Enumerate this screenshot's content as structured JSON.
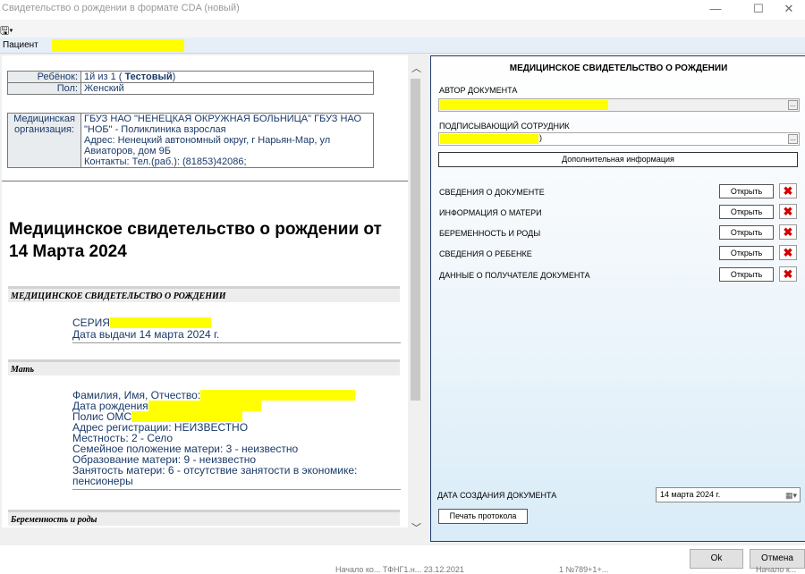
{
  "window": {
    "title": "Свидетельство о рождении в формате CDA (новый)",
    "minimize": "—",
    "maximize": "☐",
    "close": "✕"
  },
  "toolbar": {
    "menu_icon": "🖫▾"
  },
  "patient": {
    "label": "Пациент",
    "value": ""
  },
  "doc": {
    "child_label": "Ребёнок:",
    "child_value_prefix": "1й из 1 ( ",
    "child_value_bold": "Тестовый",
    "child_value_suffix": ")",
    "sex_label": "Пол:",
    "sex_value": "Женский",
    "org_label_1": "Медицинская",
    "org_label_2": "организация:",
    "org_line1": "ГБУЗ НАО \"НЕНЕЦКАЯ ОКРУЖНАЯ БОЛЬНИЦА\" ГБУЗ НАО",
    "org_line2": "\"НОБ\" - Поликлиника взрослая",
    "org_line3": "Адрес: Ненецкий автономный округ, г Нарьян-Мар, ул",
    "org_line4": "Авиаторов, дом 9Б",
    "org_line5": "Контакты: Тел.(раб.): (81853)42086;",
    "main_title": "Медицинское свидетельство о рождении от 14 Марта 2024",
    "section1_title": "МЕДИЦИНСКОЕ СВИДЕТЕЛЬСТВО О РОЖДЕНИИ",
    "series_label": "СЕРИЯ",
    "issue_date": "Дата выдачи 14 марта 2024 г.",
    "section2_title": "Мать",
    "mother_fio": "Фамилия, Имя, Отчество:",
    "mother_birth": "Дата рождения",
    "mother_oms": "Полис ОМС",
    "mother_addr": "Адрес регистрации: НЕИЗВЕСТНО",
    "mother_locality": "Местность: 2 - Село",
    "mother_family": "Семейное положение матери: 3 - неизвестно",
    "mother_edu": "Образование матери: 9 - неизвестно",
    "mother_job1": "Занятость матери: 6 - отсутствие занятости в экономике:",
    "mother_job2": "пенсионеры",
    "section3_title": "Беременность и роды"
  },
  "panel": {
    "title": "МЕДИЦИНСКОЕ СВИДЕТЕЛЬСТВО О РОЖДЕНИИ",
    "author_label": "АВТОР ДОКУМЕНТА",
    "signer_label": "ПОДПИСЫВАЮЩИЙ СОТРУДНИК",
    "signer_suffix": ")",
    "dots": "...",
    "additional_info": "Дополнительная информация",
    "sections": [
      "СВЕДЕНИЯ О ДОКУМЕНТЕ",
      "ИНФОРМАЦИЯ О МАТЕРИ",
      "БЕРЕМЕННОСТЬ И РОДЫ",
      "СВЕДЕНИЯ О РЕБЕНКЕ",
      "ДАННЫЕ О ПОЛУЧАТЕЛЕ ДОКУМЕНТА"
    ],
    "open_label": "Открыть",
    "delete_icon": "✖",
    "date_label": "ДАТА СОЗДАНИЯ ДОКУМЕНТА",
    "date_value": "14   марта   2024 г.",
    "calendar_icon": "▦▾",
    "print_label": "Печать протокола"
  },
  "footer": {
    "ok": "Ok",
    "cancel": "Отмена",
    "ghost1": "Начало ко...   ТФНГ1.н...   23.12.2021",
    "ghost2": "1   №789+1+...",
    "ghost3": "Начало к..."
  }
}
